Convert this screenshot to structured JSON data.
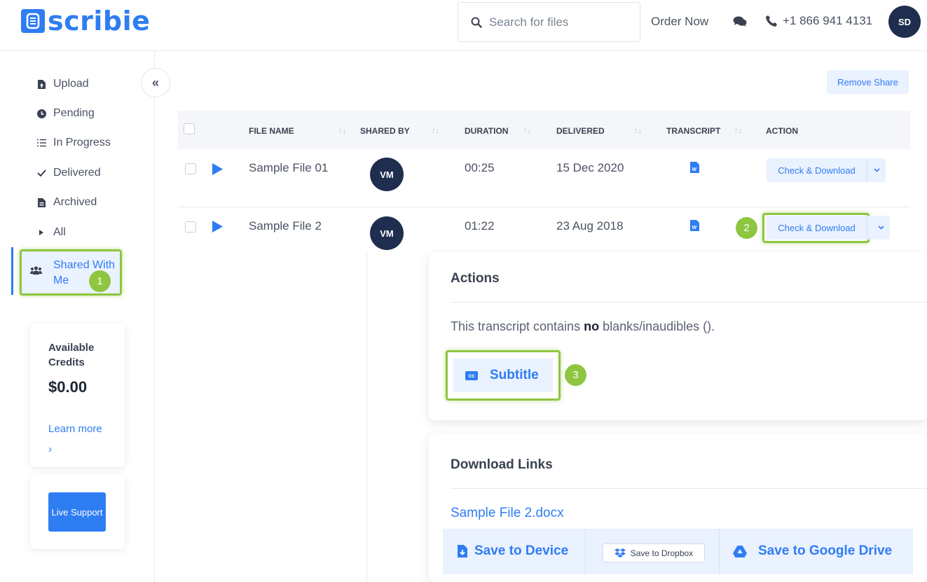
{
  "header": {
    "logo_text": "scribie",
    "search_placeholder": "Search for files",
    "order_now": "Order Now",
    "phone": "+1 866 941 4131",
    "user_initials": "SD"
  },
  "sidebar": {
    "items": [
      {
        "label": "Upload",
        "icon": "upload-file-icon"
      },
      {
        "label": "Pending",
        "icon": "clock-icon"
      },
      {
        "label": "In Progress",
        "icon": "list-icon"
      },
      {
        "label": "Delivered",
        "icon": "check-icon"
      },
      {
        "label": "Archived",
        "icon": "archive-icon"
      },
      {
        "label": "All",
        "icon": "caret-right-icon"
      },
      {
        "label": "Shared With Me",
        "icon": "users-icon",
        "active": true
      }
    ],
    "collapse_glyph": "«"
  },
  "credits": {
    "title": "Available Credits",
    "amount": "$0.00",
    "learn_more": "Learn more ›"
  },
  "support": {
    "label": "Live Support"
  },
  "table": {
    "remove_share": "Remove Share",
    "columns": [
      "FILE NAME",
      "SHARED BY",
      "DURATION",
      "DELIVERED",
      "TRANSCRIPT",
      "ACTION"
    ],
    "sort_glyph": "↑↓",
    "rows": [
      {
        "file_name": "Sample File 01",
        "shared_by": "VM",
        "duration": "00:25",
        "delivered": "15 Dec 2020",
        "action": "Check & Download"
      },
      {
        "file_name": "Sample File 2",
        "shared_by": "VM",
        "duration": "01:22",
        "delivered": "23 Aug 2018",
        "action": "Check & Download"
      }
    ]
  },
  "badges": [
    "1",
    "2",
    "3"
  ],
  "actions_panel": {
    "title": "Actions",
    "text_before": "This transcript contains ",
    "text_bold": "no",
    "text_after": " blanks/inaudibles ().",
    "subtitle_label": "Subtitle",
    "cc_glyph": "cc"
  },
  "downloads_panel": {
    "title": "Download Links",
    "file_link": "Sample File 2.docx",
    "save_device": "Save to Device",
    "save_dropbox": "Save to Dropbox",
    "save_gdrive": "Save to Google Drive"
  },
  "colors": {
    "accent": "#2f7df2",
    "highlight": "#8ec641",
    "avatar_bg": "#1f2d4f",
    "button_bg": "#eaf1ff"
  }
}
